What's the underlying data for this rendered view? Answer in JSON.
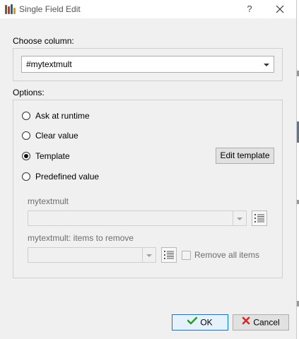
{
  "window": {
    "title": "Single Field Edit",
    "help_glyph": "?",
    "app_icon": "books-icon",
    "close_icon": "close-icon"
  },
  "column": {
    "label": "Choose column:",
    "selected": "#mytextmult"
  },
  "options": {
    "label": "Options:",
    "radios": [
      {
        "label": "Ask at runtime",
        "checked": false
      },
      {
        "label": "Clear value",
        "checked": false
      },
      {
        "label": "Template",
        "checked": true
      },
      {
        "label": "Predefined value",
        "checked": false
      }
    ],
    "edit_template_label": "Edit template",
    "field1": {
      "label": "mytextmult",
      "value": "",
      "list_icon": "list-icon"
    },
    "field2": {
      "label": "mytextmult: items to remove",
      "value": "",
      "list_icon": "list-icon",
      "remove_all_label": "Remove all items",
      "remove_all_checked": false
    }
  },
  "buttons": {
    "ok_label": "OK",
    "ok_icon": "checkmark-icon",
    "cancel_label": "Cancel",
    "cancel_icon": "x-icon"
  },
  "colors": {
    "accent": "#0078d7",
    "ok_check": "#2a9d2a",
    "cancel_x": "#d42a2a",
    "background": "#f0f0f0"
  }
}
